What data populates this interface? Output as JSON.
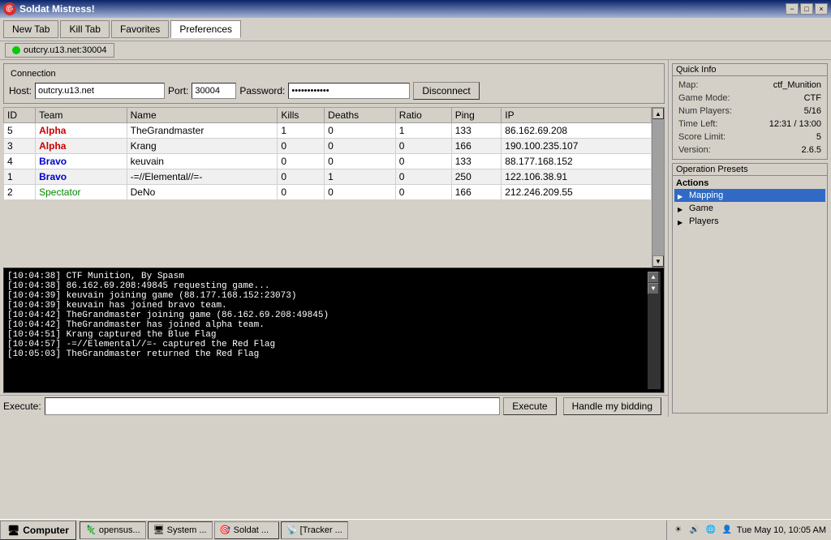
{
  "titlebar": {
    "title": "Soldat Mistress!",
    "icon": "🎯",
    "minimize": "−",
    "maximize": "□",
    "close": "×"
  },
  "menubar": {
    "tabs": [
      {
        "label": "New Tab",
        "active": false
      },
      {
        "label": "Kill Tab",
        "active": false
      },
      {
        "label": "Favorites",
        "active": false
      },
      {
        "label": "Preferences",
        "active": true
      }
    ]
  },
  "tab_indicator": {
    "server": "outcry.u13.net:30004"
  },
  "connection": {
    "legend": "Connection",
    "host_label": "Host:",
    "host_value": "outcry.u13.net",
    "port_label": "Port:",
    "port_value": "30004",
    "password_label": "Password:",
    "password_value": "••••••••••••",
    "disconnect_label": "Disconnect"
  },
  "player_table": {
    "columns": [
      "ID",
      "Team",
      "Name",
      "Kills",
      "Deaths",
      "Ratio",
      "Ping",
      "IP"
    ],
    "rows": [
      {
        "id": "5",
        "team": "Alpha",
        "team_class": "team-alpha",
        "name": "TheGrandmaster",
        "kills": "1",
        "deaths": "0",
        "ratio": "1",
        "ping": "133",
        "ip": "86.162.69.208"
      },
      {
        "id": "3",
        "team": "Alpha",
        "team_class": "team-alpha",
        "name": "Krang",
        "kills": "0",
        "deaths": "0",
        "ratio": "0",
        "ping": "166",
        "ip": "190.100.235.107"
      },
      {
        "id": "4",
        "team": "Bravo",
        "team_class": "team-bravo",
        "name": "keuvain",
        "kills": "0",
        "deaths": "0",
        "ratio": "0",
        "ping": "133",
        "ip": "88.177.168.152"
      },
      {
        "id": "1",
        "team": "Bravo",
        "team_class": "team-bravo",
        "name": "-=//Elemental//=-",
        "kills": "0",
        "deaths": "1",
        "ratio": "0",
        "ping": "250",
        "ip": "122.106.38.91"
      },
      {
        "id": "2",
        "team": "Spectator",
        "team_class": "team-spectator",
        "name": "DeNo",
        "kills": "0",
        "deaths": "0",
        "ratio": "0",
        "ping": "166",
        "ip": "212.246.209.55"
      }
    ]
  },
  "quick_info": {
    "title": "Quick Info",
    "fields": [
      {
        "label": "Map:",
        "value": "ctf_Munition"
      },
      {
        "label": "Game Mode:",
        "value": "CTF"
      },
      {
        "label": "Num Players:",
        "value": "5/16"
      },
      {
        "label": "Time Left:",
        "value": "12:31 / 13:00"
      },
      {
        "label": "Score Limit:",
        "value": "5"
      },
      {
        "label": "Version:",
        "value": "2.6.5"
      }
    ]
  },
  "operation_presets": {
    "title": "Operation Presets",
    "actions_label": "Actions",
    "items": [
      {
        "label": "Mapping",
        "selected": true
      },
      {
        "label": "Game",
        "selected": false
      },
      {
        "label": "Players",
        "selected": false
      }
    ]
  },
  "log": {
    "lines": [
      "[10:04:38] CTF Munition, By Spasm",
      "[10:04:38] 86.162.69.208:49845 requesting game...",
      "[10:04:39] keuvain joining game (88.177.168.152:23073)",
      "[10:04:39] keuvain has joined bravo team.",
      "[10:04:42] TheGrandmaster joining game (86.162.69.208:49845)",
      "[10:04:42] TheGrandmaster has joined alpha team.",
      "[10:04:51] Krang captured the Blue Flag",
      "[10:04:57] -=//Elemental//=- captured the Red Flag",
      "[10:05:03] TheGrandmaster returned the Red Flag"
    ]
  },
  "execute": {
    "label": "Execute:",
    "placeholder": "",
    "button": "Execute",
    "handle_button": "Handle my bidding"
  },
  "taskbar": {
    "start_label": "Computer",
    "items": [
      {
        "label": "opensus...",
        "icon": "🦎"
      },
      {
        "label": "System ...",
        "icon": "🖥"
      },
      {
        "label": "Soldat ...",
        "icon": "🎯"
      },
      {
        "label": "[Tracker ...",
        "icon": "📡"
      }
    ],
    "tray": {
      "time": "Tue May 10, 10:05 AM"
    }
  }
}
